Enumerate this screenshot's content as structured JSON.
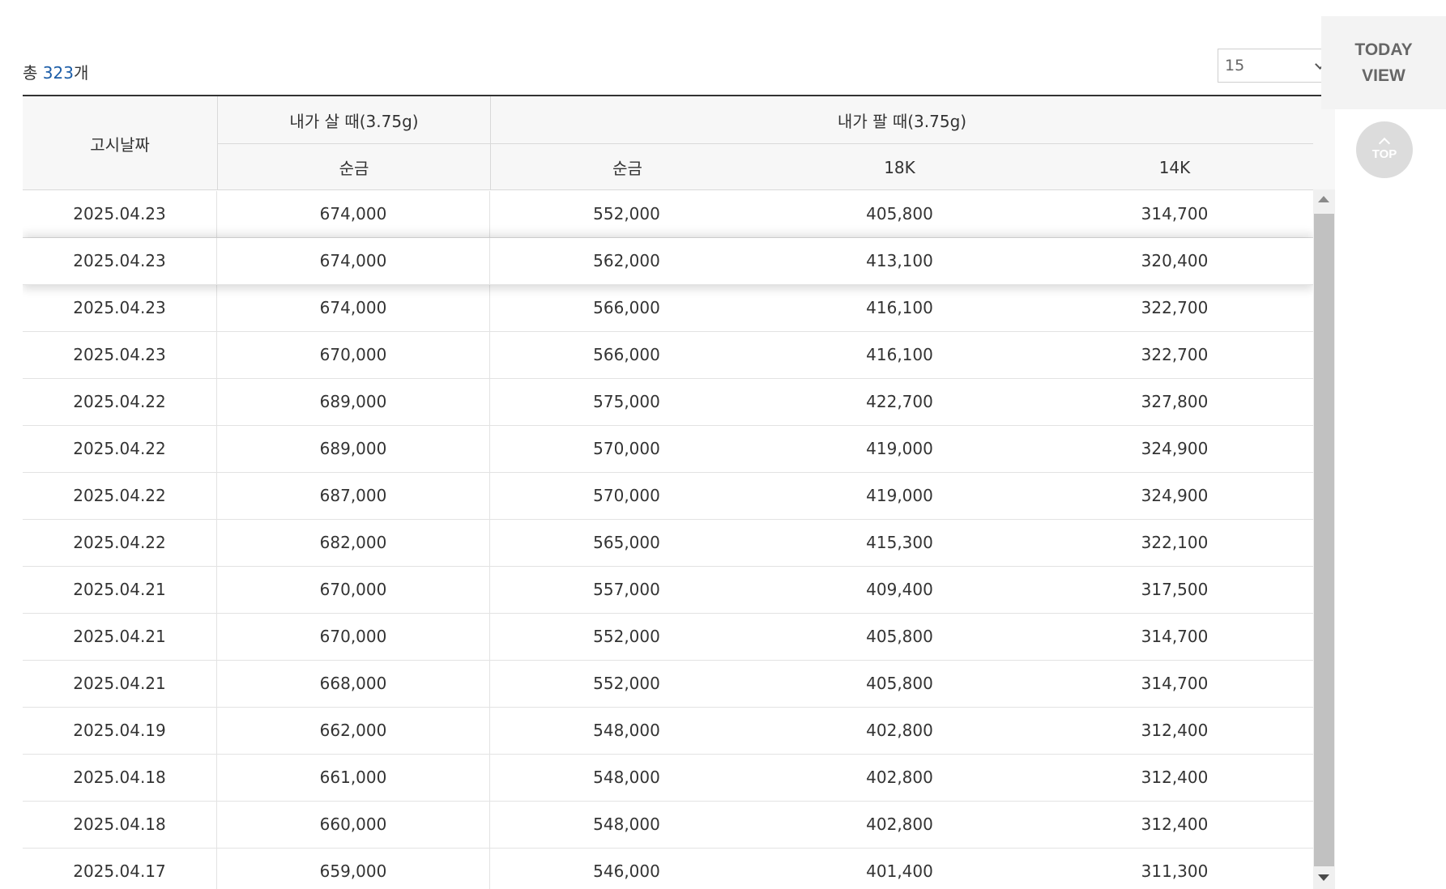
{
  "summary": {
    "prefix": "총 ",
    "count": "323",
    "suffix": "개"
  },
  "page_size": {
    "selected": "15"
  },
  "side": {
    "today": "TODAY",
    "view": "VIEW",
    "top": "TOP"
  },
  "table": {
    "headers": {
      "date": "고시날짜",
      "buy_group": "내가 살 때(3.75g)",
      "sell_group": "내가 팔 때(3.75g)",
      "buy_pure": "순금",
      "sell_pure": "순금",
      "sell_18k": "18K",
      "sell_14k": "14K"
    },
    "rows": [
      {
        "date": "2025.04.23",
        "buy": "674,000",
        "sell_pure": "552,000",
        "sell_18k": "405,800",
        "sell_14k": "314,700"
      },
      {
        "date": "2025.04.23",
        "buy": "674,000",
        "sell_pure": "562,000",
        "sell_18k": "413,100",
        "sell_14k": "320,400"
      },
      {
        "date": "2025.04.23",
        "buy": "674,000",
        "sell_pure": "566,000",
        "sell_18k": "416,100",
        "sell_14k": "322,700"
      },
      {
        "date": "2025.04.23",
        "buy": "670,000",
        "sell_pure": "566,000",
        "sell_18k": "416,100",
        "sell_14k": "322,700"
      },
      {
        "date": "2025.04.22",
        "buy": "689,000",
        "sell_pure": "575,000",
        "sell_18k": "422,700",
        "sell_14k": "327,800"
      },
      {
        "date": "2025.04.22",
        "buy": "689,000",
        "sell_pure": "570,000",
        "sell_18k": "419,000",
        "sell_14k": "324,900"
      },
      {
        "date": "2025.04.22",
        "buy": "687,000",
        "sell_pure": "570,000",
        "sell_18k": "419,000",
        "sell_14k": "324,900"
      },
      {
        "date": "2025.04.22",
        "buy": "682,000",
        "sell_pure": "565,000",
        "sell_18k": "415,300",
        "sell_14k": "322,100"
      },
      {
        "date": "2025.04.21",
        "buy": "670,000",
        "sell_pure": "557,000",
        "sell_18k": "409,400",
        "sell_14k": "317,500"
      },
      {
        "date": "2025.04.21",
        "buy": "670,000",
        "sell_pure": "552,000",
        "sell_18k": "405,800",
        "sell_14k": "314,700"
      },
      {
        "date": "2025.04.21",
        "buy": "668,000",
        "sell_pure": "552,000",
        "sell_18k": "405,800",
        "sell_14k": "314,700"
      },
      {
        "date": "2025.04.19",
        "buy": "662,000",
        "sell_pure": "548,000",
        "sell_18k": "402,800",
        "sell_14k": "312,400"
      },
      {
        "date": "2025.04.18",
        "buy": "661,000",
        "sell_pure": "548,000",
        "sell_18k": "402,800",
        "sell_14k": "312,400"
      },
      {
        "date": "2025.04.18",
        "buy": "660,000",
        "sell_pure": "548,000",
        "sell_18k": "402,800",
        "sell_14k": "312,400"
      },
      {
        "date": "2025.04.17",
        "buy": "659,000",
        "sell_pure": "546,000",
        "sell_18k": "401,400",
        "sell_14k": "311,300"
      }
    ]
  }
}
